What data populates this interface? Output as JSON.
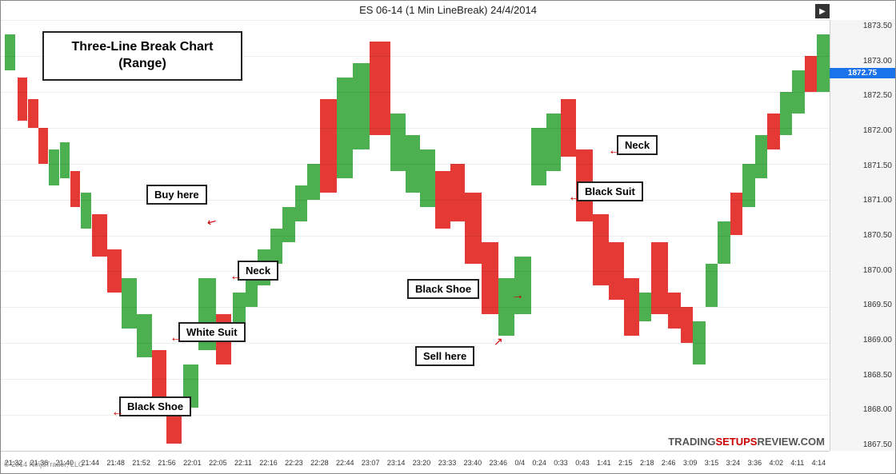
{
  "header": {
    "title": "ES 06-14 (1 Min LineBreak)  24/4/2014"
  },
  "price_axis": {
    "labels": [
      "1873.50",
      "1873.00",
      "1872.50",
      "1872.00",
      "1871.50",
      "1871.00",
      "1870.50",
      "1870.00",
      "1869.50",
      "1869.00",
      "1868.50",
      "1868.00",
      "1867.50"
    ],
    "current_price": "1872.75"
  },
  "time_axis": {
    "labels": [
      "21:32",
      "21:36",
      "21:40",
      "21:44",
      "21:48",
      "21:52",
      "21:56",
      "22:01",
      "22:05",
      "22:11",
      "22:16",
      "22:23",
      "22:28",
      "22:44",
      "23:07",
      "23:14",
      "23:20",
      "23:33",
      "23:40",
      "23:46",
      "0/4",
      "0:24",
      "0:33",
      "0:43",
      "1:41",
      "2:15",
      "2:18",
      "2:46",
      "3:09",
      "3:15",
      "3:24",
      "3:36",
      "4:02",
      "4:11",
      "4:14"
    ]
  },
  "annotations": {
    "title_box": {
      "text_line1": "Three-Line Break Chart",
      "text_line2": "(Range)"
    },
    "buy_here": "Buy here",
    "neck_lower": "Neck",
    "white_suit": "White Suit",
    "black_shoe_lower": "Black Shoe",
    "neck_upper": "Neck",
    "black_shoe_upper": "Black Shoe",
    "black_suit": "Black Suit",
    "sell_here": "Sell here"
  },
  "watermark": {
    "trading": "TRADING",
    "setups": "SETUPS",
    "review": "REVIEW",
    "dot_com": ".COM"
  },
  "copyright": "© 2014 NinjaTrader, LLC"
}
